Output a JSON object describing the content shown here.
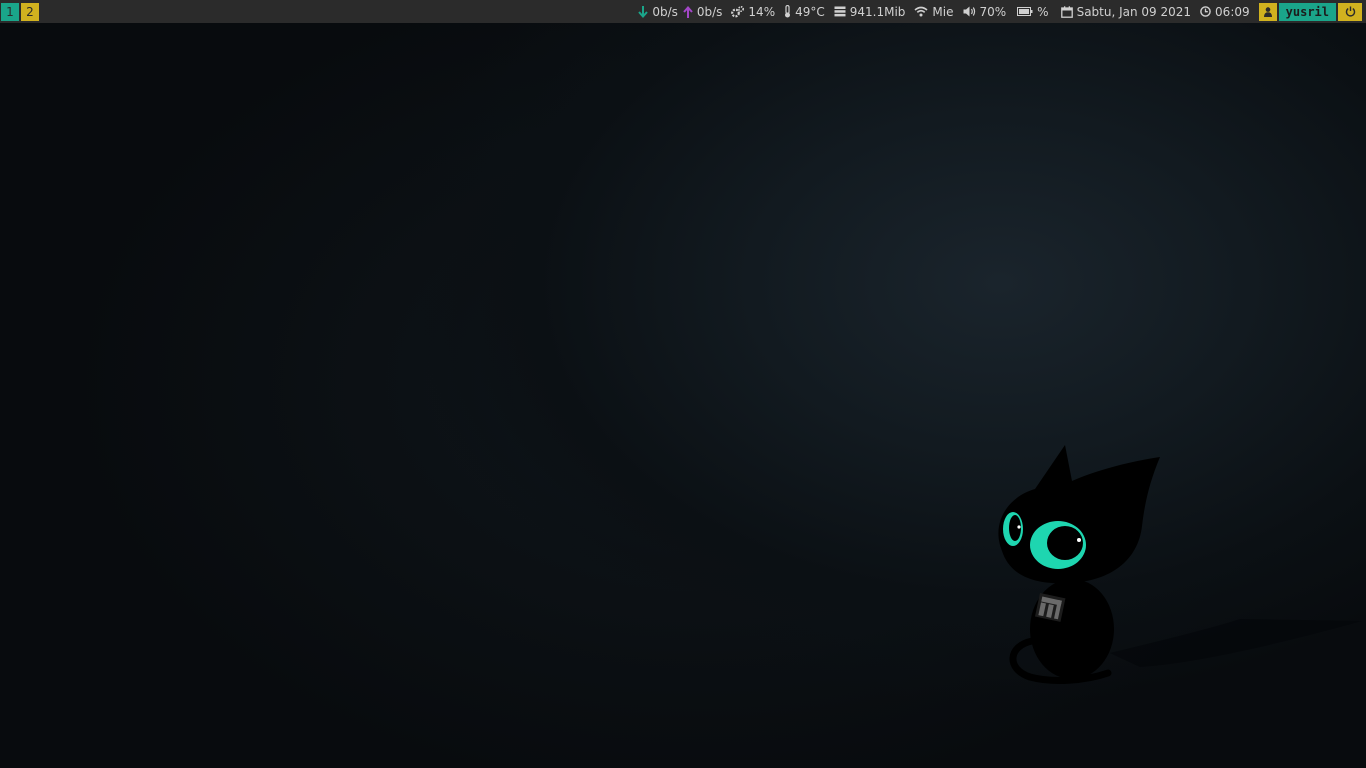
{
  "workspaces": [
    {
      "label": "1",
      "active": true
    },
    {
      "label": "2",
      "active": false
    }
  ],
  "status": {
    "net_down": "0b/s",
    "net_up": "0b/s",
    "cpu": "14%",
    "temp": "49°C",
    "memory": "941.1Mib",
    "wifi": "Mie",
    "volume": "70%",
    "battery": "%",
    "date": "Sabtu, Jan 09 2021",
    "time": "06:09",
    "user": "yusril"
  },
  "colors": {
    "bar_bg": "#2b2b2b",
    "accent_teal": "#1aa58a",
    "accent_yellow": "#d1b21f",
    "upload_purple": "#a347c7",
    "cat_eye": "#1ed6b0"
  },
  "icons": {
    "net_down": "arrow-down-icon",
    "net_up": "arrow-up-icon",
    "cpu": "gears-icon",
    "temp": "thermometer-icon",
    "memory": "memory-icon",
    "wifi": "wifi-icon",
    "volume": "speaker-icon",
    "battery": "battery-icon",
    "date": "calendar-icon",
    "time": "clock-icon",
    "user": "user-icon",
    "power": "power-icon"
  }
}
